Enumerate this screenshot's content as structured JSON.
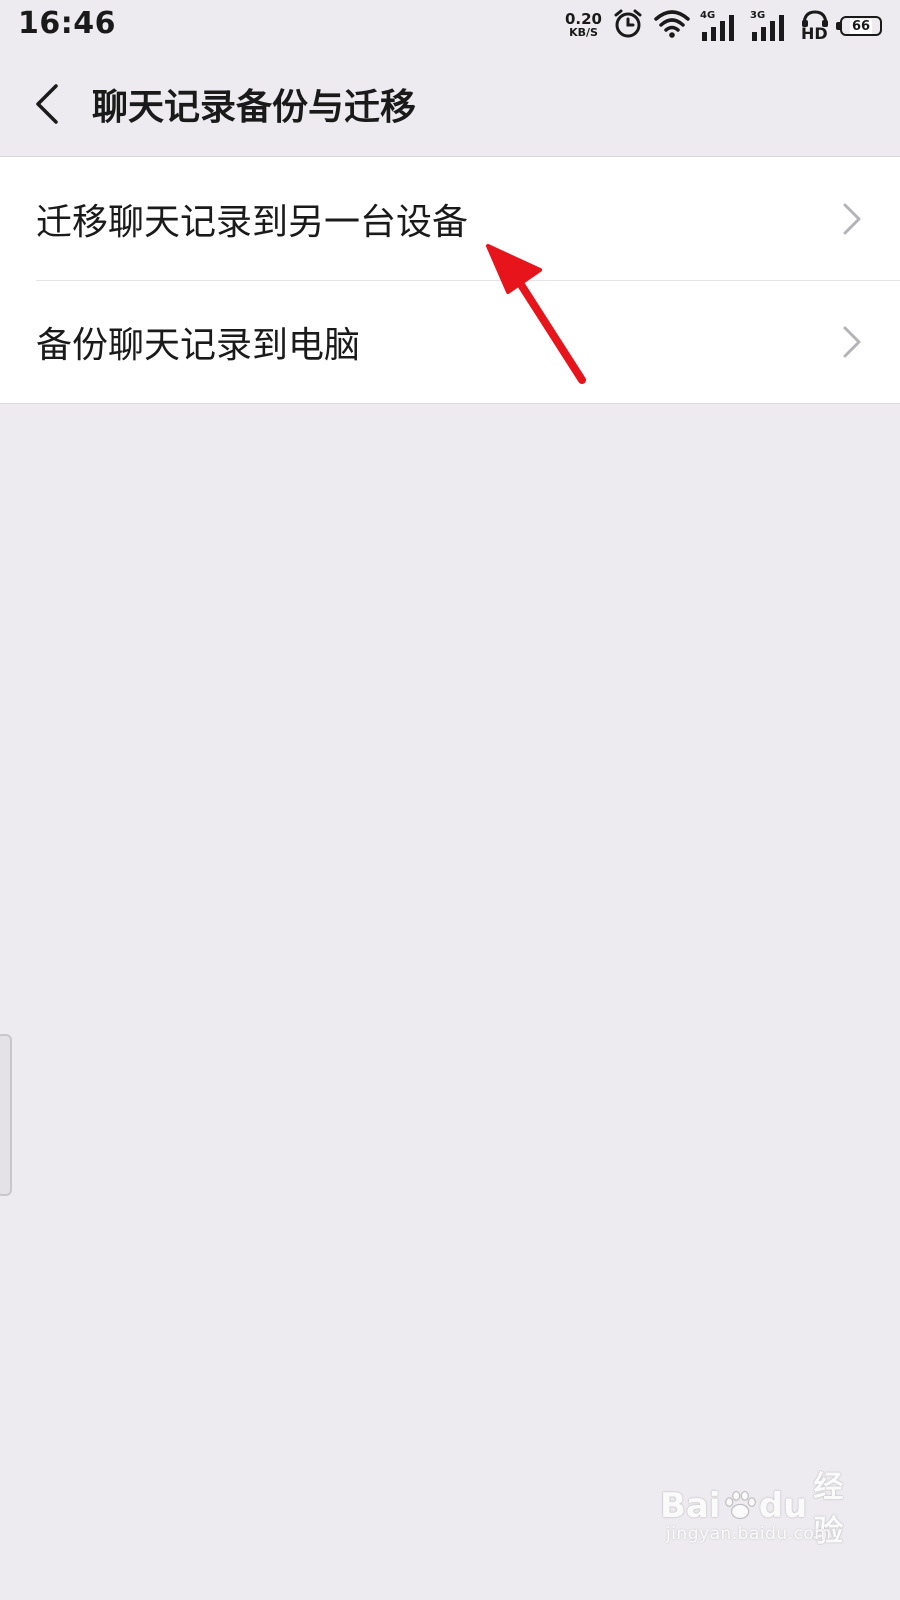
{
  "status_bar": {
    "time": "16:46",
    "net_speed_value": "0.20",
    "net_speed_unit": "KB/S",
    "signal_1_label": "4G",
    "signal_2_label": "3G",
    "hd_label": "HD",
    "battery_level": "66",
    "icons": [
      "alarm-icon",
      "wifi-icon",
      "signal-icon",
      "signal-icon",
      "hd-call-icon",
      "battery-icon"
    ]
  },
  "header": {
    "title": "聊天记录备份与迁移",
    "back_icon": "chevron-left-icon"
  },
  "menu": {
    "items": [
      {
        "label": "迁移聊天记录到另一台设备",
        "icon": "chevron-right-icon"
      },
      {
        "label": "备份聊天记录到电脑",
        "icon": "chevron-right-icon"
      }
    ]
  },
  "annotation": {
    "color": "#E8141B",
    "icon": "red-arrow-icon"
  },
  "watermark": {
    "brand_left": "Bai",
    "brand_right": "du",
    "brand_cn": "经验",
    "url": "jingyan.baidu.com"
  },
  "colors": {
    "background": "#EDEBEF",
    "card": "#FFFFFF",
    "text": "#1A1A1A",
    "chevron": "#B5B3B8"
  }
}
